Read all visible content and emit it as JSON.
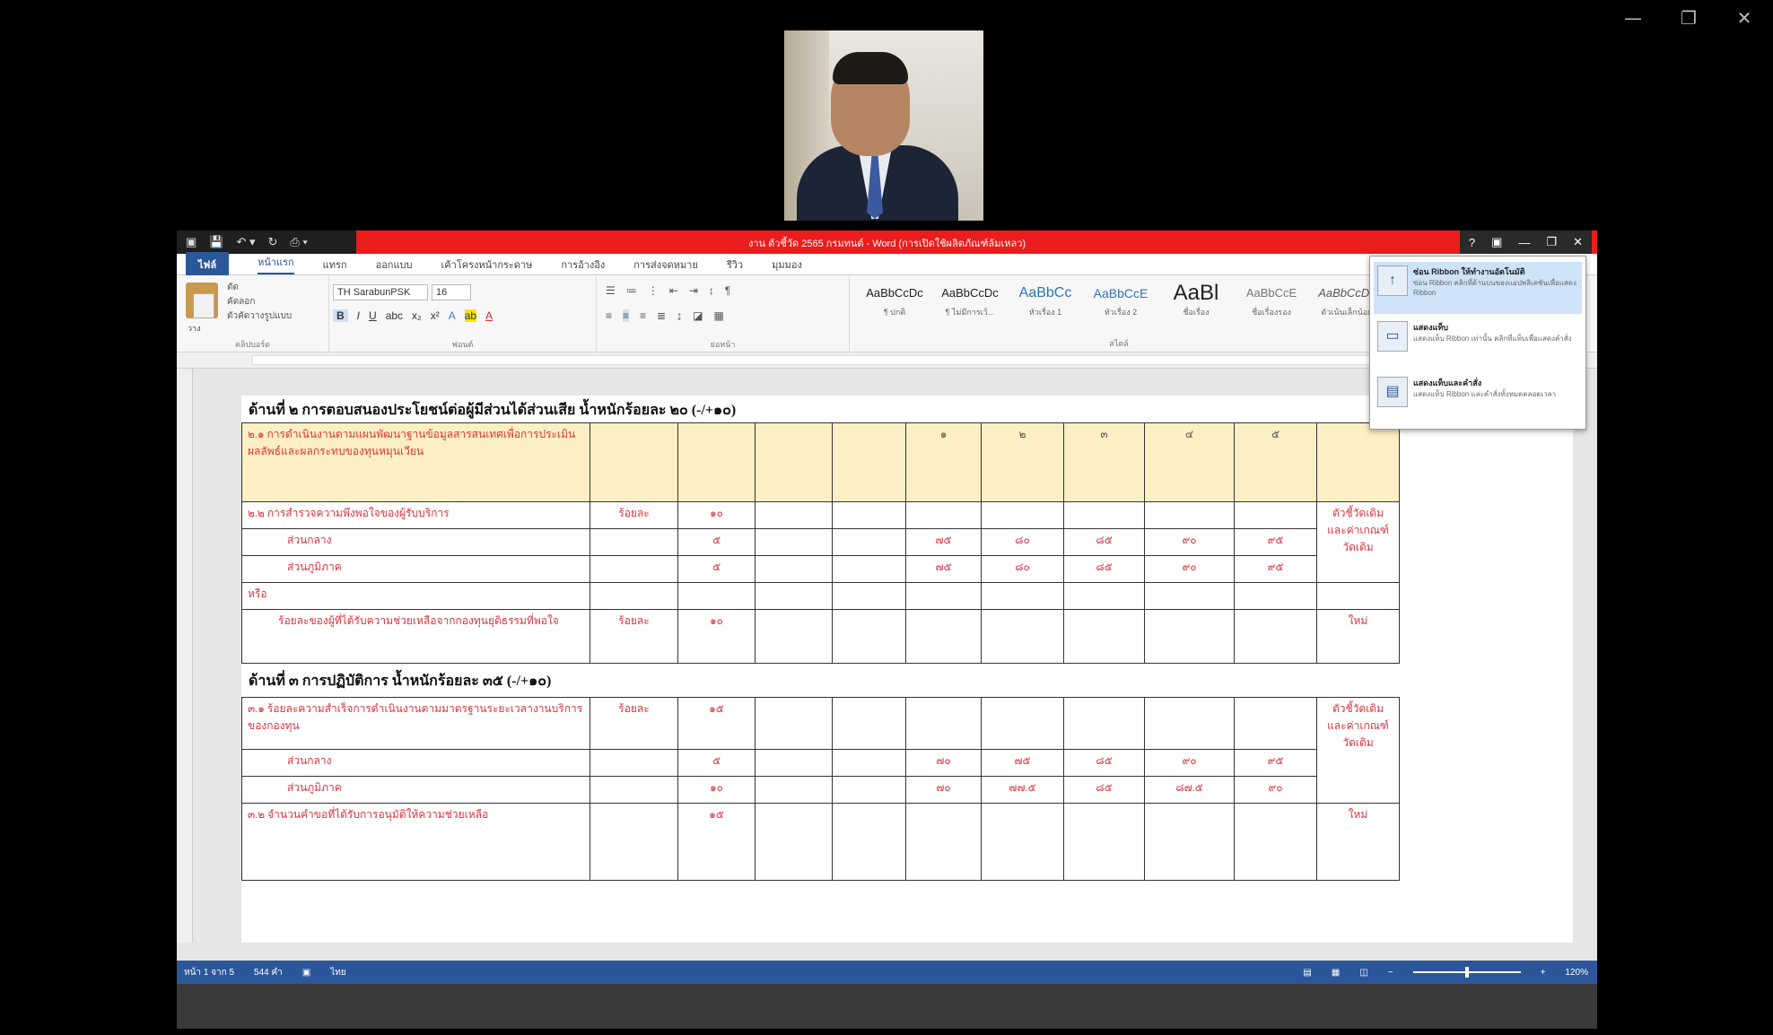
{
  "window_controls": {
    "minimize": "—",
    "restore": "❐",
    "close": "✕"
  },
  "word": {
    "title": "งาน ตัวชี้วัด 2565 กรมทนต์ - Word (การเปิดใช้ผลิตภัณฑ์ล้มเหลว)",
    "qat": [
      "▣",
      "💾",
      "↶ ▾",
      "↻",
      "⎙ ▾"
    ],
    "title_right": [
      "?",
      "▣",
      "—",
      "❐",
      "✕"
    ],
    "tabs": [
      "ไฟล์",
      "หน้าแรก",
      "แทรก",
      "ออกแบบ",
      "เค้าโครงหน้ากระดาษ",
      "การอ้างอิง",
      "การส่งจดหมาย",
      "รีวิว",
      "มุมมอง"
    ],
    "ribbon": {
      "clipboard": {
        "paste": "วาง",
        "cut": "ตัด",
        "copy": "คัดลอก",
        "format_painter": "ตัวคัดวางรูปแบบ",
        "label": "คลิปบอร์ด"
      },
      "font": {
        "name": "TH SarabunPSK",
        "size": "16",
        "bold": "B",
        "italic": "I",
        "underline": "U",
        "label": "ฟอนต์"
      },
      "paragraph": {
        "label": "ย่อหน้า"
      },
      "styles": [
        {
          "sample": "AaBbCcDc",
          "name": "¶ ปกติ"
        },
        {
          "sample": "AaBbCcDc",
          "name": "¶ ไม่มีการเว้..."
        },
        {
          "sample": "AaBbCc",
          "name": "หัวเรื่อง 1"
        },
        {
          "sample": "AaBbCcE",
          "name": "หัวเรื่อง 2"
        },
        {
          "sample": "AaBl",
          "name": "ชื่อเรื่อง"
        },
        {
          "sample": "AaBbCcE",
          "name": "ชื่อเรื่องรอง"
        },
        {
          "sample": "AaBbCcDc",
          "name": "ตัวเน้นเล็กน้อย"
        }
      ],
      "styles_label": "สไตล์"
    },
    "ribbon_menu": [
      {
        "title": "ซ่อน Ribbon ให้ทำงานอัตโนมัติ",
        "desc": "ซ่อน Ribbon คลิกที่ด้านบนของแอปพลิเคชันเพื่อแสดง Ribbon",
        "icon": "↑"
      },
      {
        "title": "แสดงแท็บ",
        "desc": "แสดงแท็บ Ribbon เท่านั้น คลิกที่แท็บเพื่อแสดงคำสั่ง",
        "icon": "▭"
      },
      {
        "title": "แสดงแท็บและคำสั่ง",
        "desc": "แสดงแท็บ Ribbon และคำสั่งทั้งหมดตลอดเวลา",
        "icon": "▤"
      }
    ],
    "doc": {
      "section2_heading": "ด้านที่ ๒  การตอบสนองประโยชน์ต่อผู้มีส่วนได้ส่วนเสีย น้ำหนักร้อยละ ๒๐ (-/+๑๐)",
      "section3_heading": "ด้านที่ ๓ การปฏิบัติการ น้ำหนักร้อยละ ๓๕ (-/+๑๐)",
      "rows2": [
        {
          "text": "๒.๑  การดำเนินงานตามแผนพัฒนาฐานข้อมูลสารสนเทศเพื่อการประเมินผลลัพธ์และผลกระทบของทุนหมุนเวียน",
          "unit": "",
          "weight": "",
          "s1": "๑",
          "s2": "๒",
          "s3": "๓",
          "s4": "๔",
          "s5": "๕",
          "note": ""
        },
        {
          "text": "๒.๒  การสำรวจความพึงพอใจของผู้รับบริการ",
          "unit": "ร้อยละ",
          "weight": "๑๐",
          "s1": "",
          "s2": "",
          "s3": "",
          "s4": "",
          "s5": "",
          "note": "ตัวชี้วัดเดิม และค่าเกณฑ์วัดเดิม"
        },
        {
          "text": "ส่วนกลาง",
          "unit": "",
          "weight": "๕",
          "s1": "๗๕",
          "s2": "๘๐",
          "s3": "๘๕",
          "s4": "๙๐",
          "s5": "๙๕",
          "note": ""
        },
        {
          "text": "ส่วนภูมิภาค",
          "unit": "",
          "weight": "๕",
          "s1": "๗๕",
          "s2": "๘๐",
          "s3": "๘๕",
          "s4": "๙๐",
          "s5": "๙๕",
          "note": ""
        },
        {
          "text": "หรือ",
          "unit": "",
          "weight": "",
          "s1": "",
          "s2": "",
          "s3": "",
          "s4": "",
          "s5": "",
          "note": ""
        },
        {
          "text": "ร้อยละของผู้ที่ได้รับความช่วยเหลือจากกองทุนยุติธรรมที่พอใจ",
          "unit": "ร้อยละ",
          "weight": "๑๐",
          "s1": "",
          "s2": "",
          "s3": "",
          "s4": "",
          "s5": "",
          "note": "ใหม่"
        }
      ],
      "rows3": [
        {
          "text": "๓.๑  ร้อยละความสำเร็จการดำเนินงานตามมาตรฐานระยะเวลางานบริการของกองทุน",
          "unit": "ร้อยละ",
          "weight": "๑๕",
          "s1": "",
          "s2": "",
          "s3": "",
          "s4": "",
          "s5": "",
          "note": "ตัวชี้วัดเดิม และค่าเกณฑ์วัดเดิม"
        },
        {
          "text": "ส่วนกลาง",
          "unit": "",
          "weight": "๕",
          "s1": "๗๐",
          "s2": "๗๕",
          "s3": "๘๕",
          "s4": "๙๐",
          "s5": "๙๕",
          "note": ""
        },
        {
          "text": "ส่วนภูมิภาค",
          "unit": "",
          "weight": "๑๐",
          "s1": "๗๐",
          "s2": "๗๗.๕",
          "s3": "๘๕",
          "s4": "๘๗.๕",
          "s5": "๙๐",
          "note": ""
        },
        {
          "text": "๓.๒  จำนวนคำขอที่ได้รับการอนุมัติให้ความช่วยเหลือ",
          "unit": "",
          "weight": "๑๕",
          "s1": "",
          "s2": "",
          "s3": "",
          "s4": "",
          "s5": "",
          "note": "ใหม่"
        }
      ]
    },
    "status": {
      "page": "หน้า 1 จาก 5",
      "words": "544 คำ",
      "lang": "ไทย",
      "zoom": "120%"
    }
  }
}
